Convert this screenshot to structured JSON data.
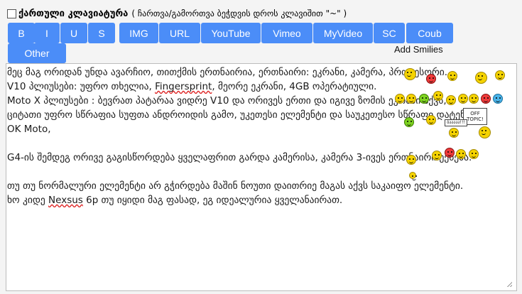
{
  "keyboard": {
    "label": "ქართული კლავიატურა",
    "hint": "( ჩართვა/გამორთვა ბეჭდვის დროს კლავიშით \"~\" )"
  },
  "toolbar": {
    "buttons": [
      {
        "label": "B"
      },
      {
        "label": "I"
      },
      {
        "label": "U"
      },
      {
        "label": "S"
      },
      {
        "label": "IMG"
      },
      {
        "label": "URL"
      },
      {
        "label": "YouTube"
      },
      {
        "label": "Vimeo"
      },
      {
        "label": "MyVideo"
      },
      {
        "label": "SC"
      },
      {
        "label": "Coub"
      },
      {
        "label": "Other"
      }
    ],
    "add_smilies": "Add Smilies"
  },
  "editor": {
    "lines": [
      "მეც მაგ ორიდან უნდა ავარჩიო, თითქმის ერთნაირია, ერთნაირი: ეკრანი, კამერა, პროცესორი.",
      "V10 პლიუსები: უფრო თხელია, ",
      "Fingersprint",
      ", მეორე ეკრანი, 4GB ოპერატიული.",
      "Moto X პლიუსები : ბევრათ პატარაა ვიდრე V10 და ორივეს ერთი და იგივე ზომის ეკრანი აქვს,",
      "ციტათი უფრო სწრაფია სუფთა ანდროიდის გამო, უკეთესი ელემენტი და საუკეთესო სწრაფი დატენვა,",
      "OK Moto,",
      "G4-ის შემდეგ ორივე გაგისწორდება ყველაფრით გარდა კამერისა, კამერა 3-ივეს ერთნაირი ექნება.",
      "თუ თუ ნორმალური ელემენტი არ გჭირდება მაშინ ნოუთი დაითრიე მაგას აქვს საკაიფო ელემენტი.",
      "ხო კიდე ",
      "Nexsus",
      " 6p თუ იყიდი მაგ ფასად, ეგ იდეალურია ყველანაირათ."
    ]
  },
  "smilies": {
    "sign1": "OFF TOPIC!",
    "sign2": "ბააააა!!!",
    "colors": {
      "yellow": "#f5d300",
      "red": "#ef3b3b",
      "green": "#7ed321",
      "blue": "#4ab3e8"
    }
  }
}
